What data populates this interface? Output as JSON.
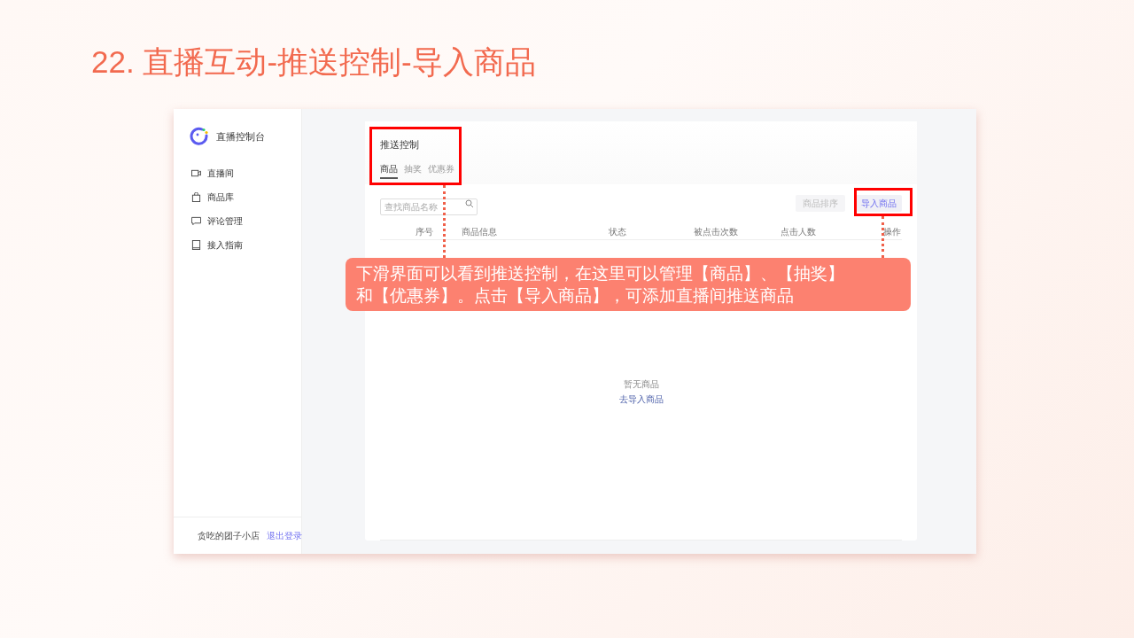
{
  "slide_title": "22. 直播互动-推送控制-导入商品",
  "sidebar": {
    "brand": "直播控制台",
    "items": [
      {
        "label": "直播间",
        "kind": "video"
      },
      {
        "label": "商品库",
        "kind": "bag"
      },
      {
        "label": "评论管理",
        "kind": "comment"
      },
      {
        "label": "接入指南",
        "kind": "book"
      }
    ],
    "user": {
      "name": "贪吃的团子小店",
      "logout": "退出登录"
    }
  },
  "panel": {
    "title": "推送控制",
    "tabs": [
      {
        "label": "商品",
        "selected": true
      },
      {
        "label": "抽奖",
        "selected": false
      },
      {
        "label": "优惠券",
        "selected": false
      }
    ],
    "search": {
      "placeholder": "查找商品名称"
    },
    "buttons": [
      {
        "label": "商品排序",
        "disabled": true
      },
      {
        "label": "导入商品",
        "disabled": false
      }
    ],
    "columns": [
      "序号",
      "商品信息",
      "状态",
      "被点击次数",
      "点击人数",
      "操作"
    ],
    "empty": {
      "text": "暂无商品",
      "link": "去导入商品"
    }
  },
  "annotation": {
    "text": "下滑界面可以看到推送控制，在这里可以管理【商品】、【抽奖】和【优惠券】。点击【导入商品】，可添加直播间推送商品"
  }
}
